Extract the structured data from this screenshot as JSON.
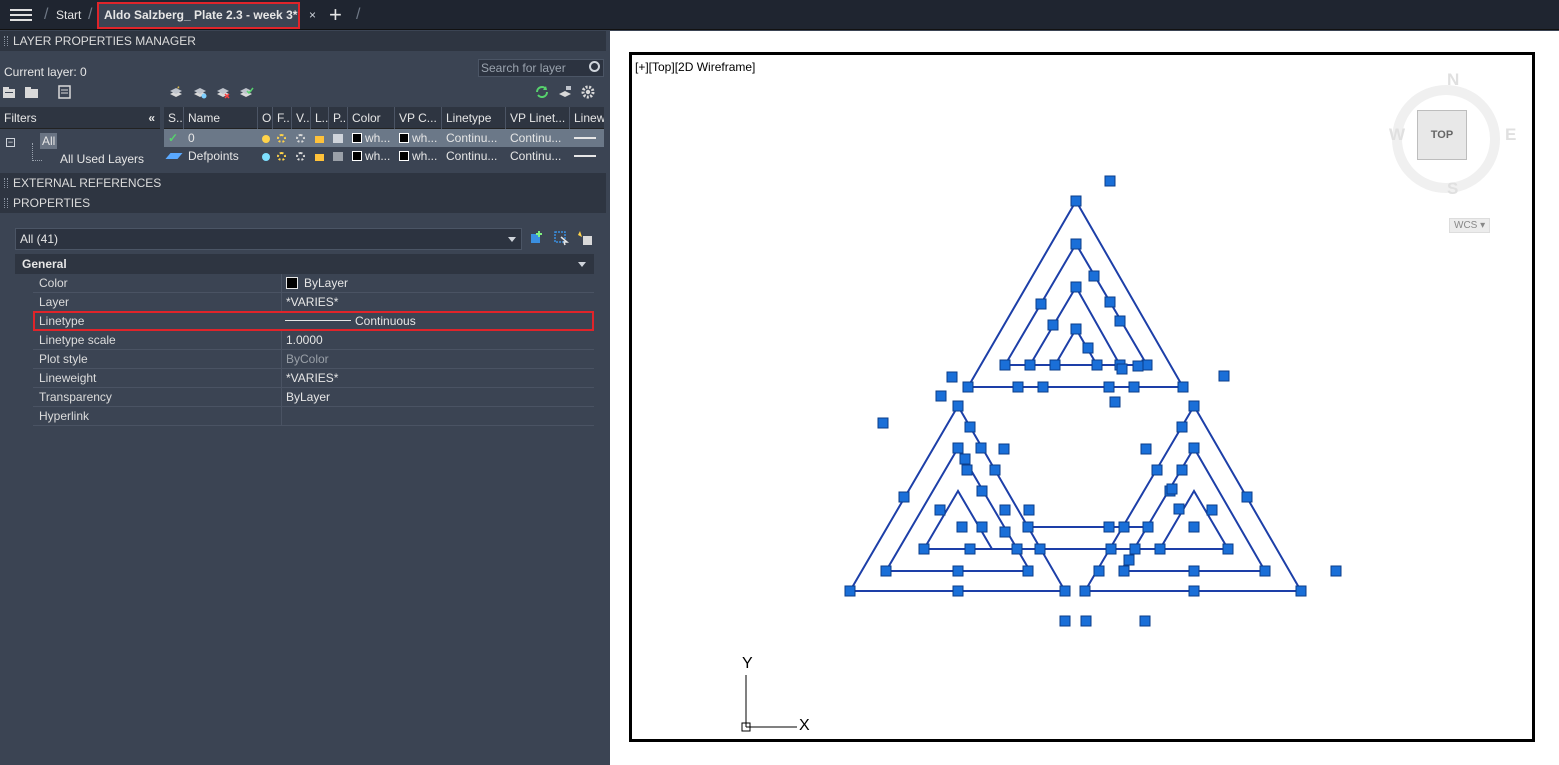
{
  "tabs": {
    "start": "Start",
    "active": "Aldo Salzberg_ Plate 2.3 - week 3*",
    "close": "×",
    "new": "+"
  },
  "lpm": {
    "title": "LAYER PROPERTIES MANAGER",
    "current_layer": "Current layer: 0",
    "search_placeholder": "Search for layer",
    "filters_label": "Filters",
    "filters_collapse": "«",
    "tree_all": "All",
    "tree_used": "All Used Layers",
    "columns": [
      "S..",
      "Name",
      "O..",
      "F..",
      "V..",
      "L..",
      "P..",
      "Color",
      "VP C...",
      "Linetype",
      "VP Linet...",
      "Linew"
    ],
    "rows": [
      {
        "name": "0",
        "color": "wh...",
        "vp_color": "wh...",
        "linetype": "Continu...",
        "vp_linetype": "Continu...",
        "current": true,
        "selected": true
      },
      {
        "name": "Defpoints",
        "color": "wh...",
        "vp_color": "wh...",
        "linetype": "Continu...",
        "vp_linetype": "Continu...",
        "current": false,
        "selected": false
      }
    ]
  },
  "xref": {
    "title": "EXTERNAL REFERENCES"
  },
  "properties": {
    "title": "PROPERTIES",
    "selection": "All (41)",
    "section": "General",
    "rows": [
      {
        "key": "Color",
        "value": "ByLayer"
      },
      {
        "key": "Layer",
        "value": "*VARIES*"
      },
      {
        "key": "Linetype",
        "value": "Continuous"
      },
      {
        "key": "Linetype scale",
        "value": "1.0000"
      },
      {
        "key": "Plot style",
        "value": "ByColor"
      },
      {
        "key": "Lineweight",
        "value": "*VARIES*"
      },
      {
        "key": "Transparency",
        "value": "ByLayer"
      },
      {
        "key": "Hyperlink",
        "value": ""
      }
    ]
  },
  "viewport": {
    "label": "[+][Top][2D Wireframe]",
    "viewcube": {
      "top": "TOP",
      "n": "N",
      "s": "S",
      "e": "E",
      "w": "W",
      "wcs": "WCS ▾"
    },
    "ucs": {
      "x": "X",
      "y": "Y"
    }
  },
  "colors": {
    "selection_red": "#e0242a",
    "grip_blue": "#1a6fd8",
    "line_blue": "#1d3fa8"
  }
}
